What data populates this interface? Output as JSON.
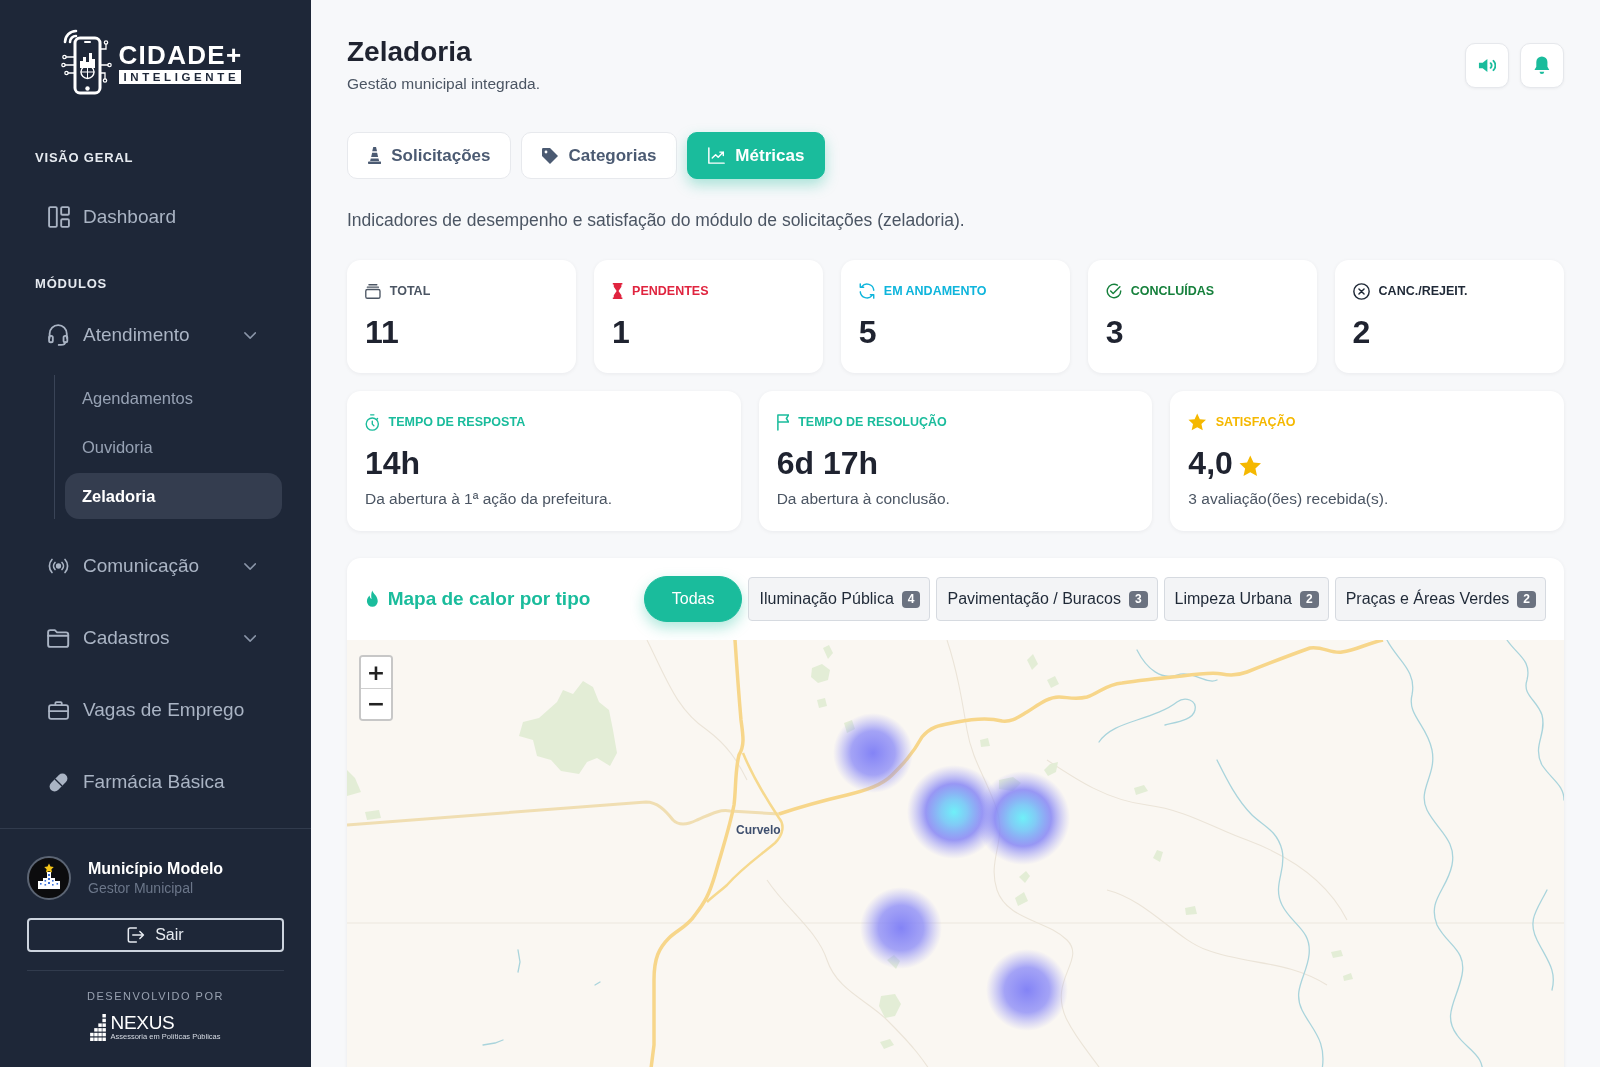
{
  "sidebar": {
    "logo": {
      "title": "CIDADE+",
      "subtitle": "INTELIGENTE"
    },
    "sections": [
      {
        "heading": "VISÃO GERAL",
        "items": [
          {
            "label": "Dashboard",
            "kind": "link",
            "selected": false
          }
        ]
      },
      {
        "heading": "MÓDULOS",
        "items": [
          {
            "label": "Atendimento",
            "kind": "group",
            "selected": false,
            "children": [
              {
                "label": "Agendamentos",
                "selected": false
              },
              {
                "label": "Ouvidoria",
                "selected": false
              },
              {
                "label": "Zeladoria",
                "selected": true
              }
            ]
          },
          {
            "label": "Comunicação",
            "kind": "group",
            "selected": false
          },
          {
            "label": "Cadastros",
            "kind": "group",
            "selected": false
          },
          {
            "label": "Vagas de Emprego",
            "kind": "link",
            "selected": false
          },
          {
            "label": "Farmácia Básica",
            "kind": "link",
            "selected": false
          }
        ]
      }
    ],
    "user": {
      "name": "Município Modelo",
      "role": "Gestor Municipal"
    },
    "logout_button": "Sair",
    "footer": {
      "caption": "DESENVOLVIDO POR",
      "brand": "NEXUS",
      "tagline": "Assessoria em Políticas Públicas"
    }
  },
  "header": {
    "title": "Zeladoria",
    "subtitle": "Gestão municipal integrada."
  },
  "tabs": [
    {
      "label": "Solicitações",
      "selected": false
    },
    {
      "label": "Categorias",
      "selected": false
    },
    {
      "label": "Métricas",
      "selected": true
    }
  ],
  "description": "Indicadores de desempenho e satisfação do módulo de solicitações (zeladoria).",
  "stats": [
    {
      "label": "TOTAL",
      "value": "11",
      "color": "#4b5563"
    },
    {
      "label": "PENDENTES",
      "value": "1",
      "color": "#e0243f"
    },
    {
      "label": "EM ANDAMENTO",
      "value": "5",
      "color": "#0fb5dc"
    },
    {
      "label": "CONCLUÍDAS",
      "value": "3",
      "color": "#16803c"
    },
    {
      "label": "CANC./REJEIT.",
      "value": "2",
      "color": "#1f2937"
    }
  ],
  "metrics": [
    {
      "kind": "time",
      "label": "TEMPO DE RESPOSTA",
      "value": "14h",
      "note": "Da abertura à 1ª ação da prefeitura.",
      "color": "#1abc9c"
    },
    {
      "kind": "time",
      "label": "TEMPO DE RESOLUÇÃO",
      "value": "6d 17h",
      "note": "Da abertura à conclusão.",
      "color": "#1abc9c"
    },
    {
      "kind": "rating",
      "label": "SATISFAÇÃO",
      "value": "4,0",
      "note": "3 avaliação(ões) recebida(s).",
      "color": "#f5b800"
    }
  ],
  "heatmap": {
    "title": "Mapa de calor por tipo",
    "filters": [
      {
        "label": "Todas",
        "selected": true
      },
      {
        "label": "Iluminação Pública",
        "count": "4",
        "selected": false
      },
      {
        "label": "Pavimentação / Buracos",
        "count": "3",
        "selected": false
      },
      {
        "label": "Limpeza Urbana",
        "count": "2",
        "selected": false
      },
      {
        "label": "Praças e Áreas Verdes",
        "count": "2",
        "selected": false
      }
    ],
    "zoom_in": "+",
    "zoom_out": "−",
    "place_label": "Curvelo"
  }
}
